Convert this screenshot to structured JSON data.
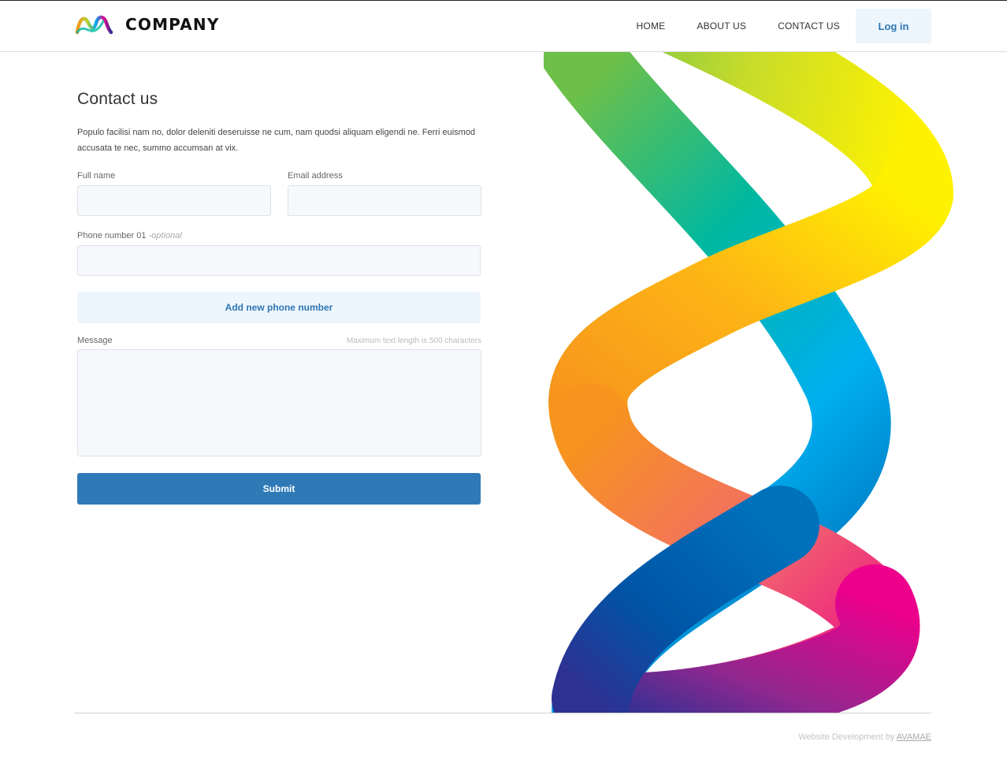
{
  "header": {
    "brand_name": "COMPANY",
    "logo_icon": "multicolor-m-logo-icon",
    "nav": [
      {
        "label": "HOME"
      },
      {
        "label": "ABOUT US"
      },
      {
        "label": "CONTACT US"
      }
    ],
    "login_label": "Log in"
  },
  "contact": {
    "title": "Contact us",
    "intro": "Populo facilisi nam no, dolor deleniti deseruisse ne cum, nam quodsi aliquam eligendi ne. Ferri euismod accusata te nec, summo accumsan at vix.",
    "full_name_label": "Full name",
    "email_label": "Email address",
    "phone_label": "Phone number 01",
    "phone_optional": " -optional",
    "add_phone_label": "Add new phone number",
    "message_label": "Message",
    "max_length_note": "Maximum text length is 500 characters",
    "submit_label": "Submit"
  },
  "footer": {
    "credit_prefix": "Website Development by ",
    "credit_link": "AVAMAE"
  },
  "colors": {
    "accent_blue": "#2f79b7",
    "light_blue_bg": "#edf5fd",
    "input_bg": "#f7f8fb"
  },
  "decoration": {
    "hero_art": "rainbow-ribbon-graphic"
  }
}
